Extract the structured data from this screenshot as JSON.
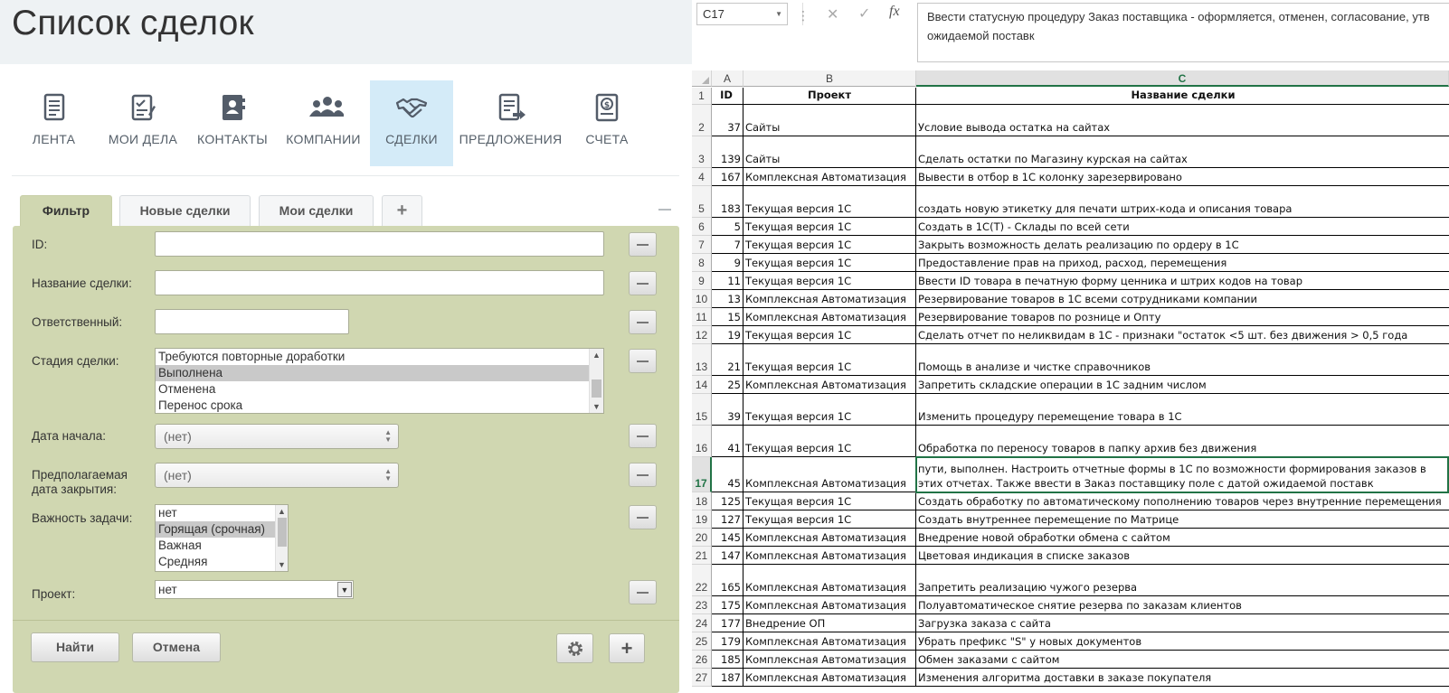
{
  "crm": {
    "title": "Список сделок",
    "nav": [
      {
        "label": "ЛЕНТА",
        "icon": "feed-icon"
      },
      {
        "label": "МОИ ДЕЛА",
        "icon": "tasks-icon"
      },
      {
        "label": "КОНТАКТЫ",
        "icon": "contacts-icon"
      },
      {
        "label": "КОМПАНИИ",
        "icon": "companies-icon"
      },
      {
        "label": "СДЕЛКИ",
        "icon": "handshake-icon",
        "active": true
      },
      {
        "label": "ПРЕДЛОЖЕНИЯ",
        "icon": "quotes-icon"
      },
      {
        "label": "СЧЕТА",
        "icon": "invoice-icon"
      }
    ],
    "filter_tabs": [
      "Фильтр",
      "Новые сделки",
      "Мои сделки",
      "+"
    ],
    "filter": {
      "id_label": "ID:",
      "id_value": "",
      "name_label": "Название сделки:",
      "name_value": "",
      "responsible_label": "Ответственный:",
      "responsible_value": "",
      "stage_label": "Стадия сделки:",
      "stage_options": [
        "Требуются повторные доработки",
        "Выполнена",
        "Отменена",
        "Перенос срока"
      ],
      "stage_selected": "Выполнена",
      "start_date_label": "Дата начала:",
      "start_date_value": "(нет)",
      "close_date_label": "Предполагаемая дата закрытия:",
      "close_date_value": "(нет)",
      "priority_label": "Важность задачи:",
      "priority_options": [
        "нет",
        "Горящая (срочная)",
        "Важная",
        "Средняя"
      ],
      "priority_selected": "Горящая (срочная)",
      "project_label": "Проект:",
      "project_value": "нет"
    },
    "buttons": {
      "find": "Найти",
      "cancel": "Отмена"
    }
  },
  "excel": {
    "name_box": "C17",
    "formula": "Ввести статусную процедуру Заказ поставщика - оформляется, отменен, согласование, утв ожидаемой поставк",
    "columns": [
      "A",
      "B",
      "C"
    ],
    "header": {
      "row": "1",
      "a": "ID",
      "b": "Проект",
      "c": "Название сделки"
    },
    "rows": [
      {
        "row": "2",
        "a": "37",
        "b": "Сайты",
        "c": "Условие вывода остатка на сайтах"
      },
      {
        "row": "3",
        "a": "139",
        "b": "Сайты",
        "c": "Сделать остатки по Магазину курская на сайтах"
      },
      {
        "row": "4",
        "a": "167",
        "b": "Комплексная Автоматизация",
        "c": "Вывести в отбор в 1С колонку зарезервировано"
      },
      {
        "row": "5",
        "a": "183",
        "b": "Текущая версия 1С",
        "c": "создать новую этикетку для печати штрих-кода и описания товара"
      },
      {
        "row": "6",
        "a": "5",
        "b": "Текущая версия 1С",
        "c": "Создать в 1С(Т) - Склады по всей сети"
      },
      {
        "row": "7",
        "a": "7",
        "b": "Текущая версия 1С",
        "c": "Закрыть возможность делать реализацию по ордеру в 1С"
      },
      {
        "row": "8",
        "a": "9",
        "b": "Текущая версия 1С",
        "c": "Предоставление прав на приход, расход, перемещения"
      },
      {
        "row": "9",
        "a": "11",
        "b": "Текущая версия 1С",
        "c": "Ввести ID товара в печатную форму ценника и штрих кодов на товар"
      },
      {
        "row": "10",
        "a": "13",
        "b": "Комплексная Автоматизация",
        "c": "Резервирование товаров в 1С всеми сотрудниками компании"
      },
      {
        "row": "11",
        "a": "15",
        "b": "Комплексная Автоматизация",
        "c": "Резервирование товаров по рознице и Опту"
      },
      {
        "row": "12",
        "a": "19",
        "b": "Текущая версия 1С",
        "c": "Сделать отчет по неликвидам в 1С - признаки \"остаток <5 шт. без движения > 0,5 года"
      },
      {
        "row": "13",
        "a": "21",
        "b": "Текущая версия 1С",
        "c": "Помощь в анализе и чистке справочников"
      },
      {
        "row": "14",
        "a": "25",
        "b": "Комплексная Автоматизация",
        "c": "Запретить складские операции в 1С задним числом"
      },
      {
        "row": "15",
        "a": "39",
        "b": "Текущая версия 1С",
        "c": "Изменить процедуру перемещение товара в 1С"
      },
      {
        "row": "16",
        "a": "41",
        "b": "Текущая версия 1С",
        "c": "Обработка по переносу товаров в папку архив без движения"
      },
      {
        "row": "17",
        "a": "45",
        "b": "Комплексная Автоматизация",
        "c": "пути, выполнен. Настроить отчетные формы в 1С по возможности формирования заказов в этих отчетах. Также ввести в Заказ поставщику поле с датой ожидаемой поставк"
      },
      {
        "row": "18",
        "a": "125",
        "b": "Текущая версия 1С",
        "c": "Создать обработку по автоматическому пополнению товаров через внутренние перемещения"
      },
      {
        "row": "19",
        "a": "127",
        "b": "Текущая версия 1С",
        "c": "Создать внутреннее перемещение по Матрице"
      },
      {
        "row": "20",
        "a": "145",
        "b": "Комплексная Автоматизация",
        "c": "Внедрение новой обработки обмена с сайтом"
      },
      {
        "row": "21",
        "a": "147",
        "b": "Комплексная Автоматизация",
        "c": "Цветовая индикация в списке заказов"
      },
      {
        "row": "22",
        "a": "165",
        "b": "Комплексная Автоматизация",
        "c": "Запретить реализацию чужого резерва"
      },
      {
        "row": "23",
        "a": "175",
        "b": "Комплексная Автоматизация",
        "c": "Полуавтоматическое снятие резерва по заказам клиентов"
      },
      {
        "row": "24",
        "a": "177",
        "b": "Внедрение ОП",
        "c": "Загрузка заказа с сайта"
      },
      {
        "row": "25",
        "a": "179",
        "b": "Комплексная Автоматизация",
        "c": "Убрать префикс \"S\" у новых документов"
      },
      {
        "row": "26",
        "a": "185",
        "b": "Комплексная Автоматизация",
        "c": "Обмен заказами с сайтом"
      },
      {
        "row": "27",
        "a": "187",
        "b": "Комплексная Автоматизация",
        "c": "Изменения алгоритма доставки в заказе покупателя"
      }
    ],
    "active_row": "17"
  },
  "colors": {
    "crm_header_bg": "#eef2f4",
    "nav_active_bg": "#d4ebf8",
    "filter_bg": "#d0d7b1",
    "excel_accent": "#217346"
  }
}
